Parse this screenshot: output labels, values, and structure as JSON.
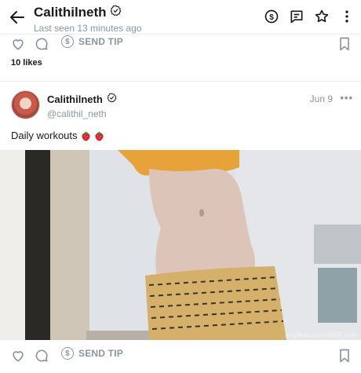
{
  "header": {
    "title": "Calithilneth",
    "last_seen": "Last seen 13 minutes ago"
  },
  "actions": {
    "send_tip": "SEND TIP"
  },
  "previous_post": {
    "likes": "10 likes"
  },
  "post": {
    "author_name": "Calithilneth",
    "author_handle": "@calithil_neth",
    "date": "Jun 9",
    "more": "•••",
    "caption": "Daily workouts"
  },
  "icons": {
    "back": "arrow-left-icon",
    "tip_header": "dollar-circle-icon",
    "message": "chat-icon",
    "star": "star-icon",
    "menu": "more-vertical-icon",
    "like": "heart-icon",
    "comment": "comment-icon",
    "bookmark": "bookmark-icon",
    "verified": "verified-icon",
    "emoji": "strawberry-icon"
  },
  "colors": {
    "muted": "#8a96a3",
    "text": "#1a1a1a",
    "divider": "#ebebeb"
  },
  "photo_watermark": "onlyfans.com/calithil_neth"
}
